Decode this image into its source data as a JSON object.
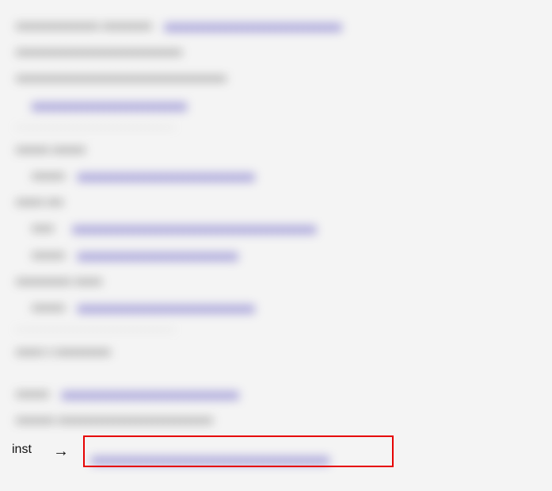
{
  "blurred": {
    "line1_text": "xxxxxxxxxxxxxxx  xxxxxxxxx",
    "line1_link": "xxxxxxxxxxxxxxxxxxxxxxxxxxxxxxxx",
    "line2": "xxxxxxxxxxxxxxxxxxxxxxxxxxxxxx",
    "line3": "xxxxxxxxxxxxxxxxxxxxxxxxxxxxxxxxxxxxxx",
    "line4_link": "xxxxxxxxxxxxxxxxxxxxxxxxxxxx",
    "line5": "xxxxxx   xxxxxx",
    "line5_sub_label": "xxxxxx",
    "line5_sub_link": "xxxxxxxxxxxxxxxxxxxxxxxxxxxxxxxx",
    "line6": "xxxxx    xxx",
    "line6_sub1_label": "xxxx",
    "line6_sub1_link": "xxxxxxxxxxxxxxxxxxxxxxxxxxxxxxxxxxxxxxxxxxxx",
    "line6_sub2_label": "xxxxxx",
    "line6_sub2_link": "xxxxxxxxxxxxxxxxxxxxxxxxxxxxx",
    "line7": "xxxxxxxxxx    xxxxx",
    "line7_sub_label": "xxxxxx",
    "line7_sub_link": "xxxxxxxxxxxxxxxxxxxxxxxxxxxxxxxx",
    "line8": "xxxxx x xxxxxxxxxx",
    "line9_label": "xxxxxx",
    "line9_link": "xxxxxxxxxxxxxxxxxxxxxxxxxxxxxxxx",
    "line10": "xxxxxxx   xxxxxxxxxxxxxxxxxxxxxxxxxxxx",
    "line11_link": "xxxxxxxxxxxxxxxxxxxxxxxxxxxxxxxxxxxxxxxxxxx"
  },
  "callout": {
    "label": "inst",
    "arrow": "→"
  }
}
